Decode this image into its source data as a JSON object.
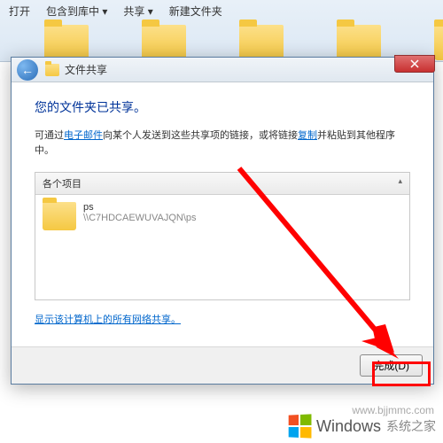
{
  "explorer": {
    "toolbar": {
      "open": "打开",
      "include": "包含到库中 ▾",
      "share": "共享 ▾",
      "newfolder": "新建文件夹"
    }
  },
  "dialog": {
    "title": "文件共享",
    "heading": "您的文件夹已共享。",
    "desc_pre": "可通过",
    "desc_link1": "电子邮件",
    "desc_mid": "向某个人发送到这些共享项的链接，或将链接",
    "desc_link2": "复制",
    "desc_post": "并粘贴到其他程序中。",
    "items_header": "各个项目",
    "item": {
      "name": "ps",
      "path": "\\\\C7HDCAEWUVAJQN\\ps"
    },
    "bottom_link": "显示该计算机上的所有网络共享。",
    "done": "完成(D)"
  },
  "watermark": {
    "brand": "Windows",
    "sub": "系统之家",
    "url": "www.bjjmmc.com"
  }
}
